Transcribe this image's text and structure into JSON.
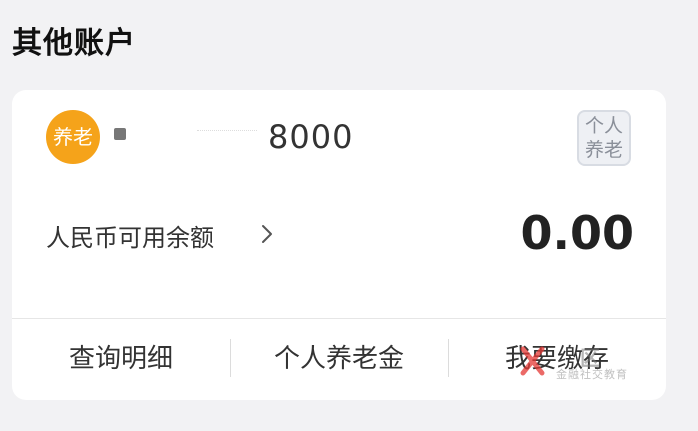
{
  "section": {
    "title": "其他账户"
  },
  "account": {
    "badge_label": "养老",
    "number_tail": "8000",
    "type_tag": [
      "个人",
      "养老"
    ],
    "balance_label": "人民币可用余额",
    "balance_value": "0.00"
  },
  "actions": [
    {
      "label": "查询明细"
    },
    {
      "label": "个人养老金"
    },
    {
      "label": "我要缴存"
    }
  ],
  "watermark": {
    "text": "区",
    "subtext": "金融社交教育"
  },
  "colors": {
    "badge": "#f5a31a",
    "card_bg": "#ffffff",
    "page_bg": "#f2f2f4",
    "tag_border": "#d8dce3",
    "tag_text": "#8a8f99",
    "watermark_accent": "#e53935"
  },
  "icons": {
    "chevron": "chevron-right-icon",
    "watermark_logo": "watermark-logo-icon"
  }
}
